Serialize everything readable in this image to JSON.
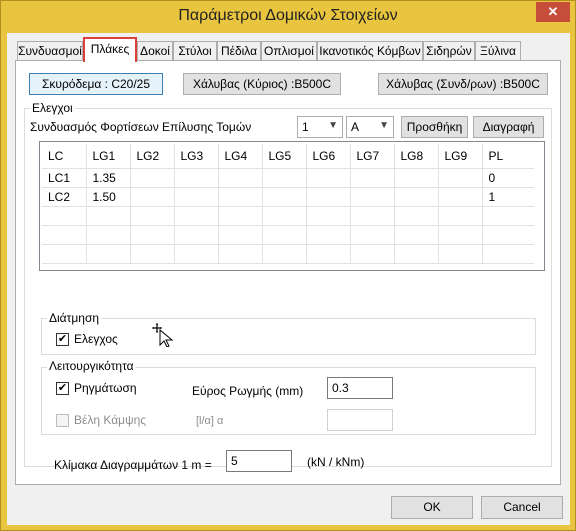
{
  "window": {
    "title": "Παράμετροι Δομικών Στοιχείων",
    "close_glyph": "✕"
  },
  "tabs": [
    {
      "label": "Συνδυασμοί",
      "active": false
    },
    {
      "label": "Πλάκες",
      "active": true
    },
    {
      "label": "Δοκοί",
      "active": false
    },
    {
      "label": "Στύλοι",
      "active": false
    },
    {
      "label": "Πέδιλα",
      "active": false
    },
    {
      "label": "Οπλισμοί",
      "active": false
    },
    {
      "label": "Ικανοτικός Κόμβων",
      "active": false
    },
    {
      "label": "Σιδηρών",
      "active": false
    },
    {
      "label": "Ξύλινα",
      "active": false
    }
  ],
  "materials": {
    "concrete_label": "Σκυρόδεμα : C20/25",
    "steel_main_label": "Χάλυβας  (Κύριος) :B500C",
    "steel_secondary_label": "Χάλυβας  (Συνδ/ρων) :B500C"
  },
  "checks": {
    "group_label": "Ελεγχοι",
    "combo_label": "Συνδυασμός Φορτίσεων Επίλυσης Τομών",
    "number_select": "1",
    "letter_select": "A",
    "add_label": "Προσθήκη",
    "delete_label": "Διαγραφή",
    "table": {
      "headers": [
        "LC",
        "LG1",
        "LG2",
        "LG3",
        "LG4",
        "LG5",
        "LG6",
        "LG7",
        "LG8",
        "LG9",
        "PL"
      ],
      "rows": [
        [
          "LC1",
          "1.35",
          "",
          "",
          "",
          "",
          "",
          "",
          "",
          "",
          "0"
        ],
        [
          "LC2",
          "1.50",
          "",
          "",
          "",
          "",
          "",
          "",
          "",
          "",
          "1"
        ],
        [
          "",
          "",
          "",
          "",
          "",
          "",
          "",
          "",
          "",
          "",
          ""
        ],
        [
          "",
          "",
          "",
          "",
          "",
          "",
          "",
          "",
          "",
          "",
          ""
        ],
        [
          "",
          "",
          "",
          "",
          "",
          "",
          "",
          "",
          "",
          "",
          ""
        ]
      ]
    }
  },
  "shear": {
    "group_label": "Διάτμηση",
    "check_label": "Ελεγχος",
    "checked": true
  },
  "serviceability": {
    "group_label": "Λειτουργικότητα",
    "cracking_label": "Ρηγμάτωση",
    "cracking_checked": true,
    "crack_width_label": "Εύρος Ρωγμής (mm)",
    "crack_width_value": "0.3",
    "deflection_label": "Βέλη Κάμψης",
    "deflection_checked": false,
    "ratio_label": "[l/α] α",
    "ratio_value": ""
  },
  "scale": {
    "label": "Κλίμακα Διαγραμμάτων 1 m =",
    "value": "5",
    "unit": "(kN / kNm)"
  },
  "footer": {
    "ok_label": "OK",
    "cancel_label": "Cancel"
  }
}
